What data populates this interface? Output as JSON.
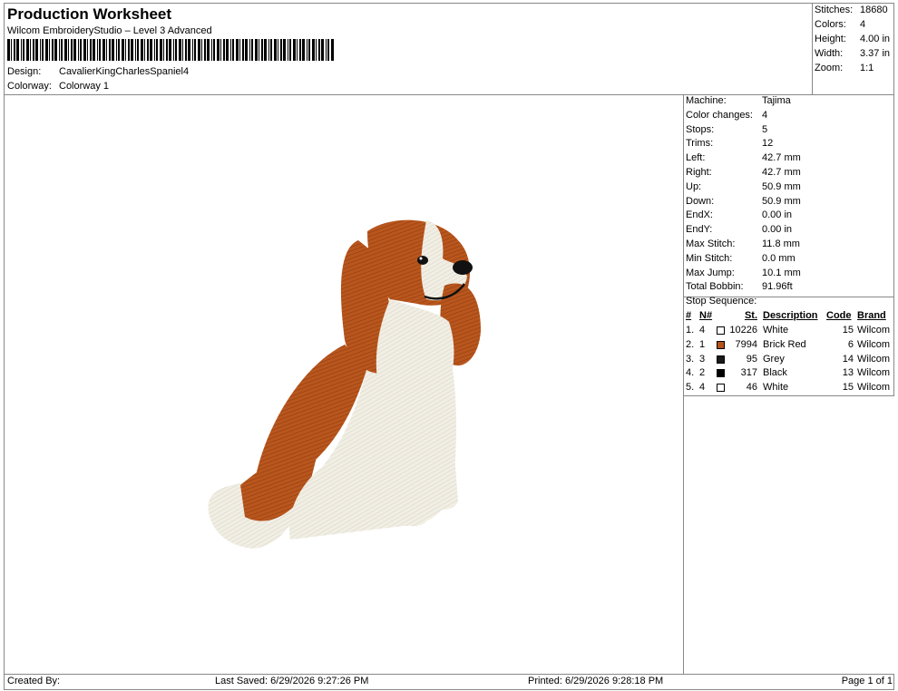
{
  "header": {
    "title": "Production Worksheet",
    "software": "Wilcom EmbroideryStudio – Level 3 Advanced",
    "design_label": "Design:",
    "design_value": "CavalierKingCharlesSpaniel4",
    "colorway_label": "Colorway:",
    "colorway_value": "Colorway 1"
  },
  "summary": {
    "stitches_label": "Stitches:",
    "stitches_value": "18680",
    "colors_label": "Colors:",
    "colors_value": "4",
    "height_label": "Height:",
    "height_value": "4.00 in",
    "width_label": "Width:",
    "width_value": "3.37 in",
    "zoom_label": "Zoom:",
    "zoom_value": "1:1"
  },
  "machine_info": [
    {
      "label": "Machine:",
      "value": "Tajima"
    },
    {
      "label": "Color changes:",
      "value": "4"
    },
    {
      "label": "Stops:",
      "value": "5"
    },
    {
      "label": "Trims:",
      "value": "12"
    },
    {
      "label": "Left:",
      "value": "42.7 mm"
    },
    {
      "label": "Right:",
      "value": "42.7 mm"
    },
    {
      "label": "Up:",
      "value": "50.9 mm"
    },
    {
      "label": "Down:",
      "value": "50.9 mm"
    },
    {
      "label": "EndX:",
      "value": "0.00 in"
    },
    {
      "label": "EndY:",
      "value": "0.00 in"
    },
    {
      "label": "Max Stitch:",
      "value": "11.8 mm"
    },
    {
      "label": "Min Stitch:",
      "value": "0.0 mm"
    },
    {
      "label": "Max Jump:",
      "value": "10.1 mm"
    },
    {
      "label": "Total Bobbin:",
      "value": "91.96ft"
    }
  ],
  "stop_sequence": {
    "title": "Stop Sequence:",
    "headers": {
      "num": "#",
      "n": "N#",
      "st": "St.",
      "desc": "Description",
      "code": "Code",
      "brand": "Brand"
    },
    "rows": [
      {
        "num": "1.",
        "n": "4",
        "color": "#ffffff",
        "st": "10226",
        "desc": "White",
        "code": "15",
        "brand": "Wilcom"
      },
      {
        "num": "2.",
        "n": "1",
        "color": "#b5521c",
        "st": "7994",
        "desc": "Brick Red",
        "code": "6",
        "brand": "Wilcom"
      },
      {
        "num": "3.",
        "n": "3",
        "color": "#1a1a1a",
        "st": "95",
        "desc": "Grey",
        "code": "14",
        "brand": "Wilcom"
      },
      {
        "num": "4.",
        "n": "2",
        "color": "#000000",
        "st": "317",
        "desc": "Black",
        "code": "13",
        "brand": "Wilcom"
      },
      {
        "num": "5.",
        "n": "4",
        "color": "#ffffff",
        "st": "46",
        "desc": "White",
        "code": "15",
        "brand": "Wilcom"
      }
    ]
  },
  "footer": {
    "created_by": "Created By:",
    "last_saved": "Last Saved: 6/29/2026 9:27:26 PM",
    "printed": "Printed: 6/29/2026 9:28:18 PM",
    "page": "Page 1 of 1"
  },
  "design_image": {
    "subject": "embroidered Cavalier King Charles Spaniel, sitting",
    "colors": [
      "#f2efe6",
      "#b5521c",
      "#555555",
      "#000000"
    ]
  }
}
